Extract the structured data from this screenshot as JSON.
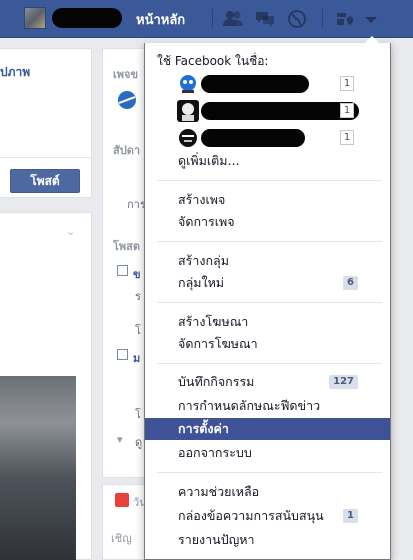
{
  "topbar": {
    "home_label": "หน้าหลัก",
    "icons": [
      "friend-requests-icon",
      "messages-icon",
      "notifications-globe-icon",
      "privacy-shortcuts-icon",
      "account-menu-arrow-icon"
    ]
  },
  "background": {
    "left_title": "ปภาพ",
    "post_label": "โพสต์",
    "right_texts": [
      "เพจข",
      "สัปดา",
      "การ",
      "โพสต",
      "ข",
      "ร",
      "โ",
      "ม",
      "โ",
      "ดู"
    ],
    "gift_label": "วัน",
    "right_bottom": "เชิญ"
  },
  "menu": {
    "header": "ใช้ Facebook ในชื่อ:",
    "accounts": [
      {
        "count": "1",
        "avatar": "blue-mascot-avatar"
      },
      {
        "count": "1",
        "avatar": "white-mascot-avatar"
      },
      {
        "count": "1",
        "avatar": "black-mascot-avatar"
      }
    ],
    "see_more": "ดูเพิ่มเติม...",
    "items": [
      {
        "label": "สร้างเพจ"
      },
      {
        "label": "จัดการเพจ"
      },
      {
        "label": "สร้างกลุ่ม"
      },
      {
        "label": "กลุ่มใหม่",
        "badge": "6"
      },
      {
        "label": "สร้างโฆษณา"
      },
      {
        "label": "จัดการโฆษณา"
      },
      {
        "label": "บันทึกกิจกรรม",
        "badge": "127"
      },
      {
        "label": "การกำหนดลักษณะฟีดข่าว"
      },
      {
        "label": "การตั้งค่า"
      },
      {
        "label": "ออกจากระบบ"
      },
      {
        "label": "ความช่วยเหลือ"
      },
      {
        "label": "กล่องข้อความการสนับสนุน",
        "badge": "1"
      },
      {
        "label": "รายงานปัญหา"
      }
    ]
  }
}
